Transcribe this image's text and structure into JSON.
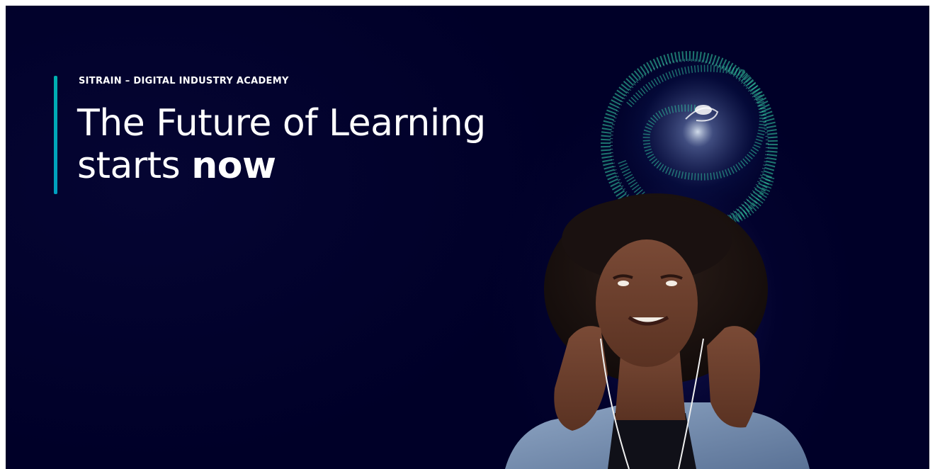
{
  "hero": {
    "eyebrow": "SITRAIN – DIGITAL INDUSTRY ACADEMY",
    "headline_line1": "The Future of Learning",
    "headline_line2_prefix": "starts ",
    "headline_line2_emphasis": "now"
  },
  "colors": {
    "background": "#000028",
    "accent": "#00B0B0",
    "text": "#FFFFFF",
    "sphere_teal": "#35D6A8"
  },
  "illustration": {
    "sphere": "particle-sphere",
    "person": "woman-looking-up-with-earphones"
  }
}
